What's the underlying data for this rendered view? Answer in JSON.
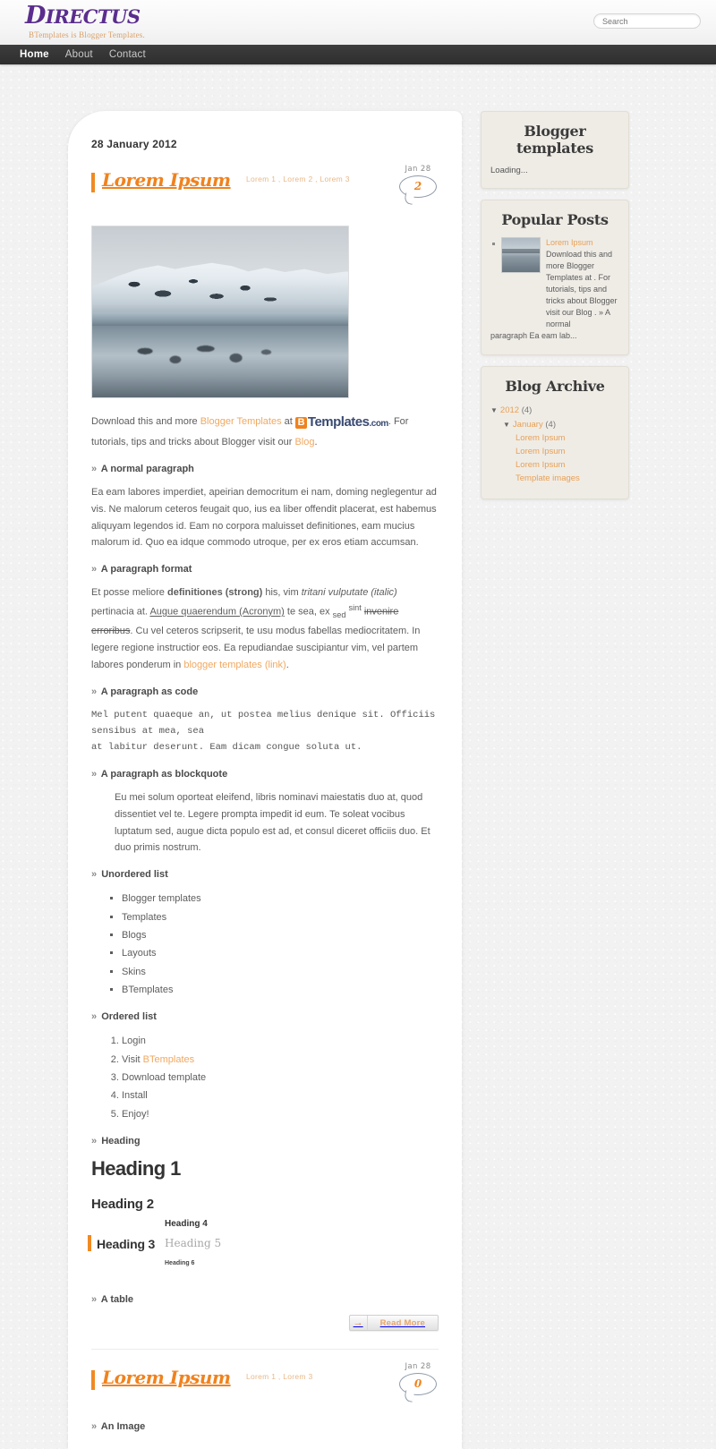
{
  "header": {
    "logo_main": "D",
    "logo_rest": "IRECTUS",
    "tagline": "BTemplates is Blogger Templates.",
    "search_placeholder": "Search",
    "search_value": ""
  },
  "nav": {
    "items": [
      {
        "label": "Home",
        "active": true
      },
      {
        "label": "About",
        "active": false
      },
      {
        "label": "Contact",
        "active": false
      }
    ]
  },
  "main": {
    "date_header": "28 January 2012",
    "posts": [
      {
        "title": "Lorem Ipsum",
        "labels": "Lorem 1 , Lorem 2 , Lorem 3",
        "comment_date": "Jan 28",
        "comment_count": "2",
        "intro_pre": "Download this and more ",
        "intro_link1": "Blogger Templates",
        "intro_mid": " at ",
        "brand_b": "B",
        "brand_name": "Templates",
        "brand_com": ".com",
        "intro_post": ". For tutorials, tips and tricks about Blogger visit our ",
        "intro_link2": "Blog",
        "intro_end": ".",
        "h_normal": "A normal paragraph",
        "p_normal": "Ea eam labores imperdiet, apeirian democritum ei nam, doming neglegentur ad vis. Ne malorum ceteros feugait quo, ius ea liber offendit placerat, est habemus aliquyam legendos id. Eam no corpora maluisset definitiones, eam mucius malorum id. Quo ea idque commodo utroque, per ex eros etiam accumsan.",
        "h_format": "A paragraph format",
        "fmt_1": "Et posse meliore ",
        "fmt_strong": "definitiones (strong)",
        "fmt_2": " his, vim ",
        "fmt_italic": "tritani vulputate (italic)",
        "fmt_3": " pertinacia at. ",
        "fmt_underline": "Augue quaerendum (Acronym)",
        "fmt_4": " te sea, ex ",
        "fmt_sub": "sed",
        "fmt_sup": "sint",
        "fmt_strike": "invenire erroribus",
        "fmt_5": ". Cu vel ceteros scripserit, te usu modus fabellas mediocritatem. In legere regione instructior eos. Ea repudiandae suscipiantur vim, vel partem labores ponderum in ",
        "fmt_link": "blogger templates (link)",
        "fmt_6": ".",
        "h_code": "A paragraph as code",
        "code_text": "Mel putent quaeque an, ut postea melius denique sit. Officiis sensibus at mea, sea\nat labitur deserunt. Eam dicam congue soluta ut.",
        "h_quote": "A paragraph as blockquote",
        "quote_text": "Eu mei solum oporteat eleifend, libris nominavi maiestatis duo at, quod dissentiet vel te. Legere prompta impedit id eum. Te soleat vocibus luptatum sed, augue dicta populo est ad, et consul diceret officiis duo. Et duo primis nostrum.",
        "h_ul": "Unordered list",
        "ul_items": [
          "Blogger templates",
          "Templates",
          "Blogs",
          "Layouts",
          "Skins",
          "BTemplates"
        ],
        "h_ol": "Ordered list",
        "ol_items": [
          "Login",
          "Visit BTemplates",
          "Download template",
          "Install",
          "Enjoy!"
        ],
        "ol_link_text": "BTemplates",
        "h_heading": "Heading",
        "heading1": "Heading 1",
        "heading2": "Heading 2",
        "heading3": "Heading 3",
        "heading4": "Heading 4",
        "heading5": "Heading 5",
        "heading6": "Heading 6",
        "h_table": "A table",
        "read_more": "Read More",
        "arrow_icon": "→"
      },
      {
        "title": "Lorem Ipsum",
        "labels": "Lorem 1 , Lorem 3",
        "comment_date": "Jan 28",
        "comment_count": "0",
        "h_image": "An Image"
      }
    ]
  },
  "sidebar": {
    "widgets": [
      {
        "title": "Blogger templates",
        "loading": "Loading..."
      },
      {
        "title": "Popular Posts",
        "post_title": "Lorem Ipsum",
        "post_excerpt": "Download this and more Blogger Templates at . For tutorials, tips and tricks about Blogger visit our Blog . » A normal",
        "post_excerpt_tail": "paragraph Ea eam lab..."
      },
      {
        "title": "Blog Archive",
        "year": "2012",
        "year_count": "(4)",
        "month": "January",
        "month_count": "(4)",
        "posts": [
          "Lorem Ipsum",
          "Lorem Ipsum",
          "Lorem Ipsum",
          "Template images"
        ],
        "triangle": "▼"
      }
    ]
  },
  "colors": {
    "accent_orange": "#f0821e",
    "link_orange": "#f0a860",
    "logo_purple": "#5b2d8e",
    "nav_dark": "#333333",
    "widget_bg": "#efece6"
  }
}
